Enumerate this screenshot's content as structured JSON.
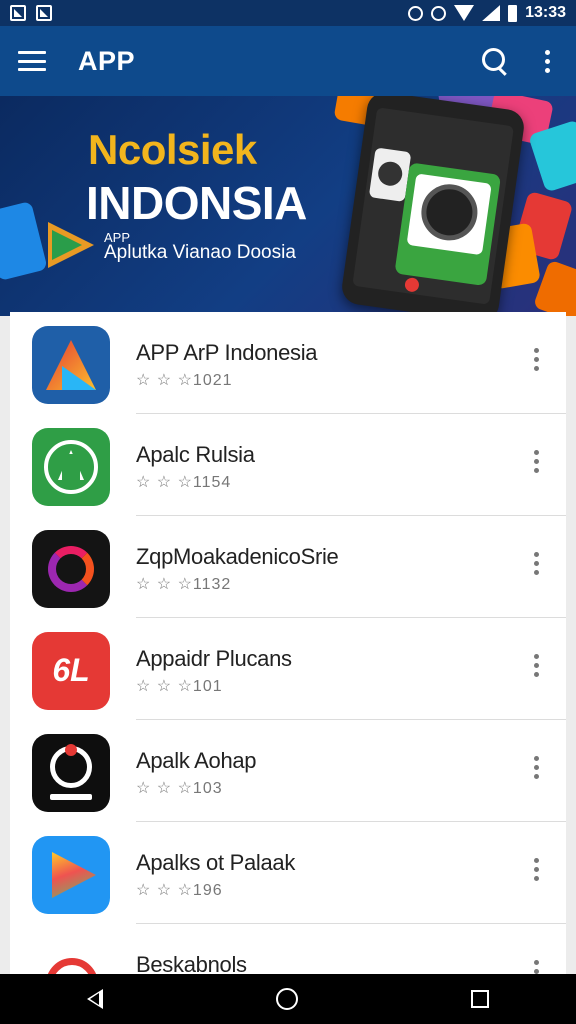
{
  "status_bar": {
    "time": "13:33",
    "icons": [
      "image-notification-icon",
      "photo-notification-icon",
      "alarm-icon",
      "alarm-icon",
      "wifi-icon",
      "signal-icon",
      "battery-icon"
    ]
  },
  "app_bar": {
    "title": "APP",
    "icons": [
      "menu-icon",
      "search-icon",
      "more-vert-icon"
    ]
  },
  "banner": {
    "title_line1": "Ncolsiek",
    "title_line2": "INDONSIA",
    "small_label": "APP",
    "subtitle": "Aplutka Vianao Doosia",
    "colors": {
      "title_accent": "#f2b51d",
      "background": "#0b2a60"
    }
  },
  "apps": [
    {
      "name": "APP ArP Indonesia",
      "rating": "☆ ☆ ☆1021",
      "icon": "red-yellow-triangle-logo-icon"
    },
    {
      "name": "Apalc Rulsia",
      "rating": "☆ ☆ ☆1154",
      "icon": "green-letter-a-logo-icon"
    },
    {
      "name": "ZqpMoakadenicoSrie",
      "rating": "☆ ☆ ☆1132",
      "icon": "purple-swirl-logo-icon"
    },
    {
      "name": "Appaidr Plucans",
      "rating": "☆ ☆ ☆101",
      "icon": "red-6l-logo-icon"
    },
    {
      "name": "Apalk Aohap",
      "rating": "☆ ☆ ☆103",
      "icon": "black-circle-logo-icon"
    },
    {
      "name": "Apalks ot Palaak",
      "rating": "☆ ☆ ☆196",
      "icon": "play-triangle-logo-icon"
    },
    {
      "name": "Beskabnols",
      "rating": "",
      "icon": "red-blob-logo-icon"
    }
  ],
  "nav_bar": {
    "icons": [
      "back-icon",
      "home-icon",
      "recent-apps-icon"
    ]
  }
}
